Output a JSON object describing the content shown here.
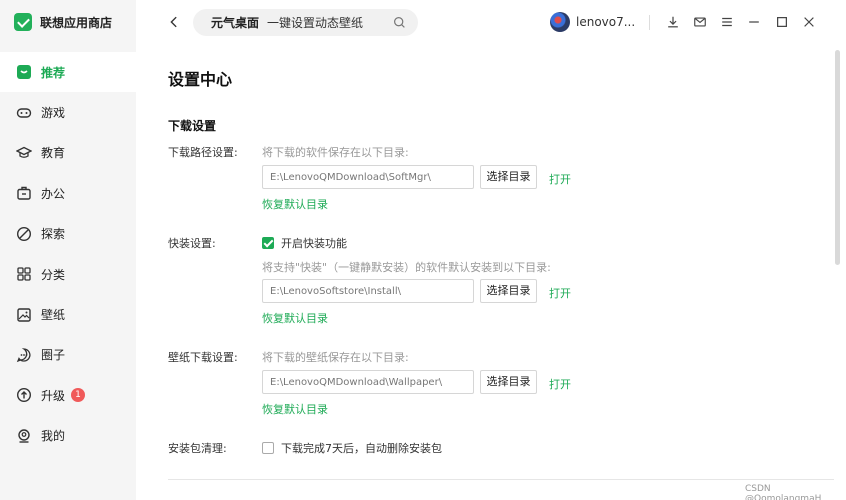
{
  "app": {
    "name": "联想应用商店"
  },
  "sidebar": {
    "items": [
      {
        "label": "推荐",
        "icon": "recommend-icon",
        "active": true
      },
      {
        "label": "游戏",
        "icon": "gamepad-icon"
      },
      {
        "label": "教育",
        "icon": "graduation-cap-icon"
      },
      {
        "label": "办公",
        "icon": "briefcase-icon"
      },
      {
        "label": "探索",
        "icon": "compass-icon"
      },
      {
        "label": "分类",
        "icon": "grid-icon"
      },
      {
        "label": "壁纸",
        "icon": "image-icon"
      },
      {
        "label": "圈子",
        "icon": "chat-icon"
      },
      {
        "label": "升级",
        "icon": "upgrade-icon",
        "badge": "1"
      },
      {
        "label": "我的",
        "icon": "user-icon"
      }
    ]
  },
  "topbar": {
    "search_keyword": "元气桌面",
    "search_value": "一键设置动态壁纸",
    "username": "lenovo7..."
  },
  "main": {
    "title": "设置中心",
    "section": "下载设置",
    "download_path": {
      "label": "下载路径设置:",
      "hint": "将下载的软件保存在以下目录:",
      "value": "E:\\LenovoQMDownload\\SoftMgr\\",
      "choose": "选择目录",
      "open": "打开",
      "restore": "恢复默认目录"
    },
    "quick_install": {
      "label": "快装设置:",
      "checkbox": "开启快装功能",
      "checked": true,
      "hint": "将支持\"快装\"（一键静默安装）的软件默认安装到以下目录:",
      "value": "E:\\LenovoSoftstore\\Install\\",
      "choose": "选择目录",
      "open": "打开",
      "restore": "恢复默认目录"
    },
    "wallpaper": {
      "label": "壁纸下载设置:",
      "hint": "将下载的壁纸保存在以下目录:",
      "value": "E:\\LenovoQMDownload\\Wallpaper\\",
      "choose": "选择目录",
      "open": "打开",
      "restore": "恢复默认目录"
    },
    "cleanup": {
      "label": "安装包清理:",
      "checkbox": "下载完成7天后，自动删除安装包",
      "checked": false
    }
  },
  "watermark": "CSDN @QomolangmaH",
  "colors": {
    "accent": "#1daa55",
    "badge": "#f05a5a",
    "sidebar_bg": "#f5f5f5"
  }
}
